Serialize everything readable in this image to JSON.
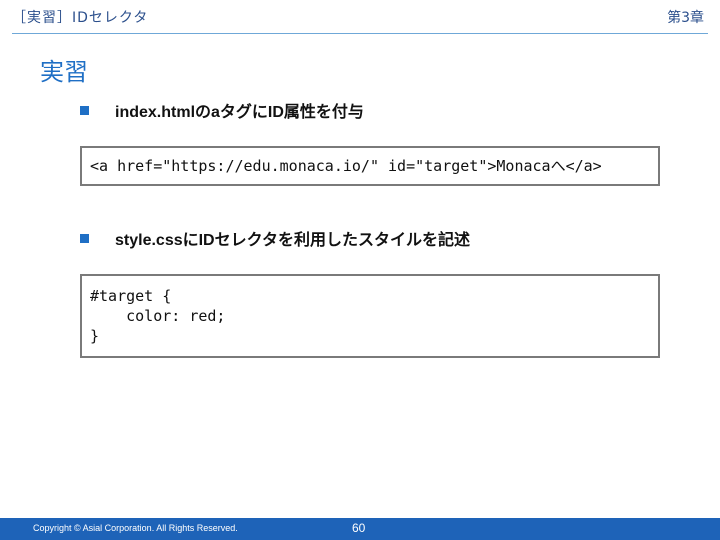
{
  "header": {
    "section_title": "［実習］IDセレクタ",
    "chapter": "第3章"
  },
  "slide": {
    "title": "実習",
    "bullets": [
      "index.htmlのaタグにID属性を付与",
      "style.cssにIDセレクタを利用したスタイルを記述"
    ],
    "code_html": "<a href=\"https://edu.monaca.io/\" id=\"target\">Monacaへ</a>",
    "code_css": "#target {\n    color: red;\n}"
  },
  "footer": {
    "copyright": "Copyright © Asial Corporation. All Rights Reserved.",
    "page_number": "60"
  },
  "colors": {
    "accent": "#1f6fc5",
    "footer_bg": "#1e63b8"
  }
}
